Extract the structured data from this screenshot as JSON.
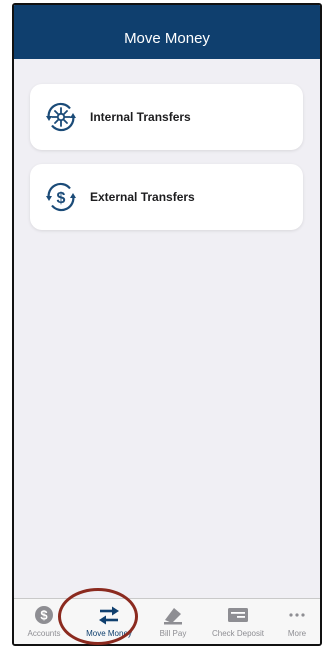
{
  "header": {
    "title": "Move Money"
  },
  "menu": {
    "items": [
      {
        "label": "Internal Transfers",
        "icon": "internal-transfer-icon"
      },
      {
        "label": "External Transfers",
        "icon": "external-transfer-icon"
      }
    ]
  },
  "tabbar": {
    "active": "Move Money",
    "tabs": [
      {
        "label": "Accounts",
        "icon": "dollar-circle-icon"
      },
      {
        "label": "Move Money",
        "icon": "transfer-arrows-icon"
      },
      {
        "label": "Bill Pay",
        "icon": "bill-pay-icon"
      },
      {
        "label": "Check Deposit",
        "icon": "check-icon"
      },
      {
        "label": "More",
        "icon": "more-dots-icon"
      }
    ]
  },
  "colors": {
    "header_bg": "#0f3f6e",
    "accent": "#0f3f6e",
    "page_bg": "#f0eff4",
    "highlight_ring": "#8b2a1f",
    "inactive_tab": "#8e8e93"
  }
}
